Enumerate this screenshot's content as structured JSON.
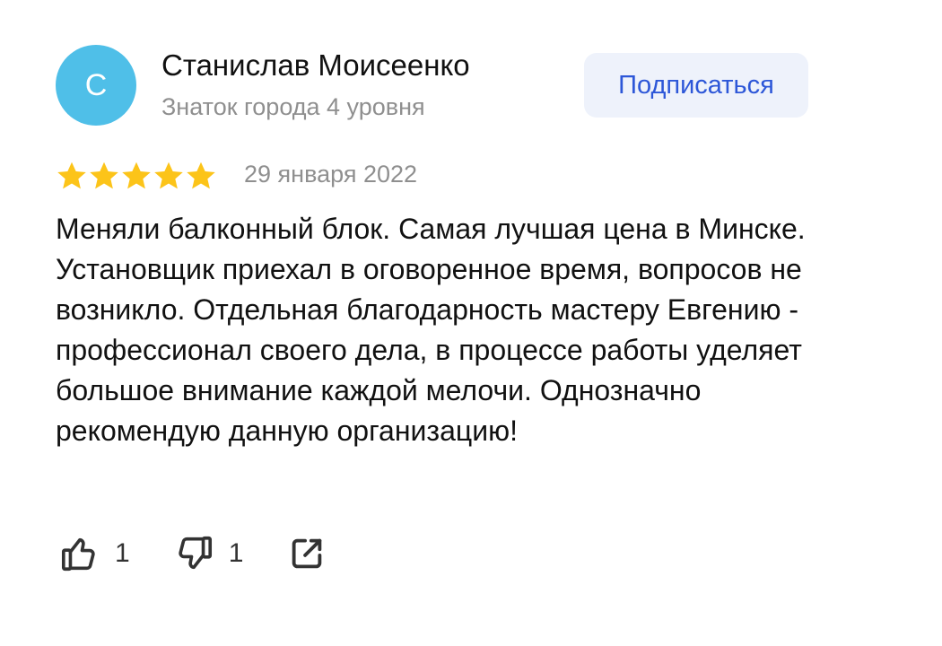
{
  "author": {
    "avatar_letter": "С",
    "avatar_color": "#4fbfe8",
    "name": "Станислав Моисеенко",
    "level": "Знаток города 4 уровня"
  },
  "subscribe": {
    "label": "Подписаться"
  },
  "review": {
    "rating": 5,
    "rating_max": 5,
    "star_color": "#fcc419",
    "date": "29 января 2022",
    "text": "Меняли балконный блок. Самая лучшая цена в Минске. Установщик приехал в оговоренное время, вопросов не возникло. Отдельная благодарность мастеру Евгению - профессионал своего дела, в процессе работы уделяет большое внимание каждой мелочи. Однозначно рекомендую данную организацию!"
  },
  "actions": {
    "likes": "1",
    "dislikes": "1",
    "like_icon": "thumbs-up-icon",
    "dislike_icon": "thumbs-down-icon",
    "share_icon": "share-icon"
  }
}
